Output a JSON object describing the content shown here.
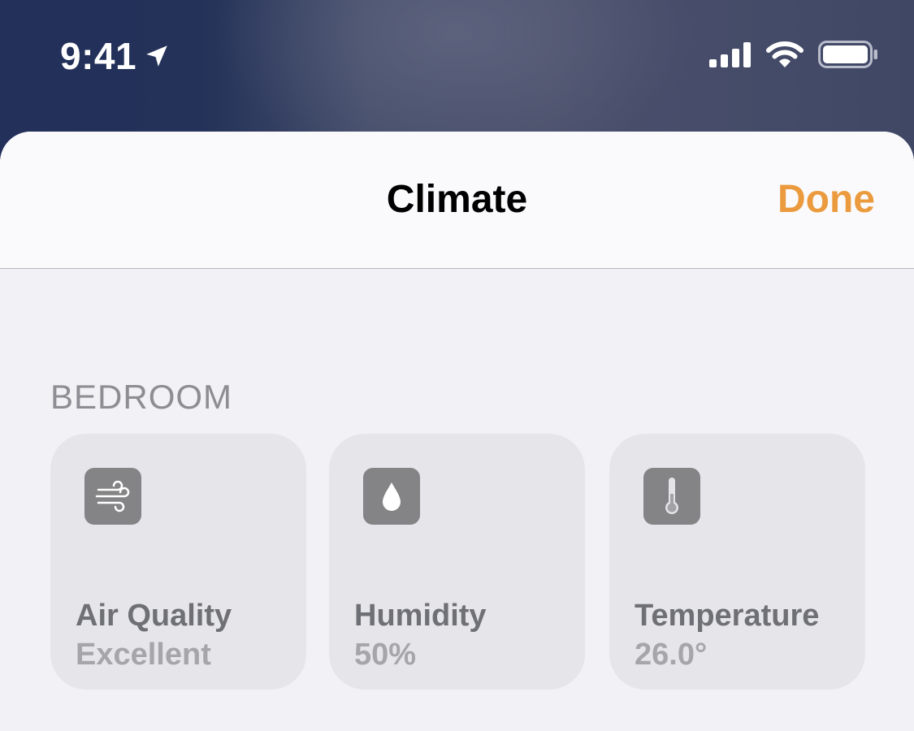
{
  "status_bar": {
    "time": "9:41",
    "location_icon": "location-arrow-icon",
    "signal_icon": "cellular-signal-icon",
    "wifi_icon": "wifi-icon",
    "battery_icon": "battery-icon"
  },
  "nav": {
    "title": "Climate",
    "done_label": "Done"
  },
  "section": {
    "header": "BEDROOM"
  },
  "tiles": [
    {
      "name": "Air Quality",
      "value": "Excellent",
      "icon": "wind-icon"
    },
    {
      "name": "Humidity",
      "value": "50%",
      "icon": "droplet-icon"
    },
    {
      "name": "Temperature",
      "value": "26.0°",
      "icon": "thermometer-icon"
    }
  ],
  "colors": {
    "accent": "#eb9b3e",
    "tile_background": "#e5e5ea",
    "icon_tile": "#848486",
    "sheet_background": "#f1f1f6",
    "nav_background": "#fafafc"
  }
}
